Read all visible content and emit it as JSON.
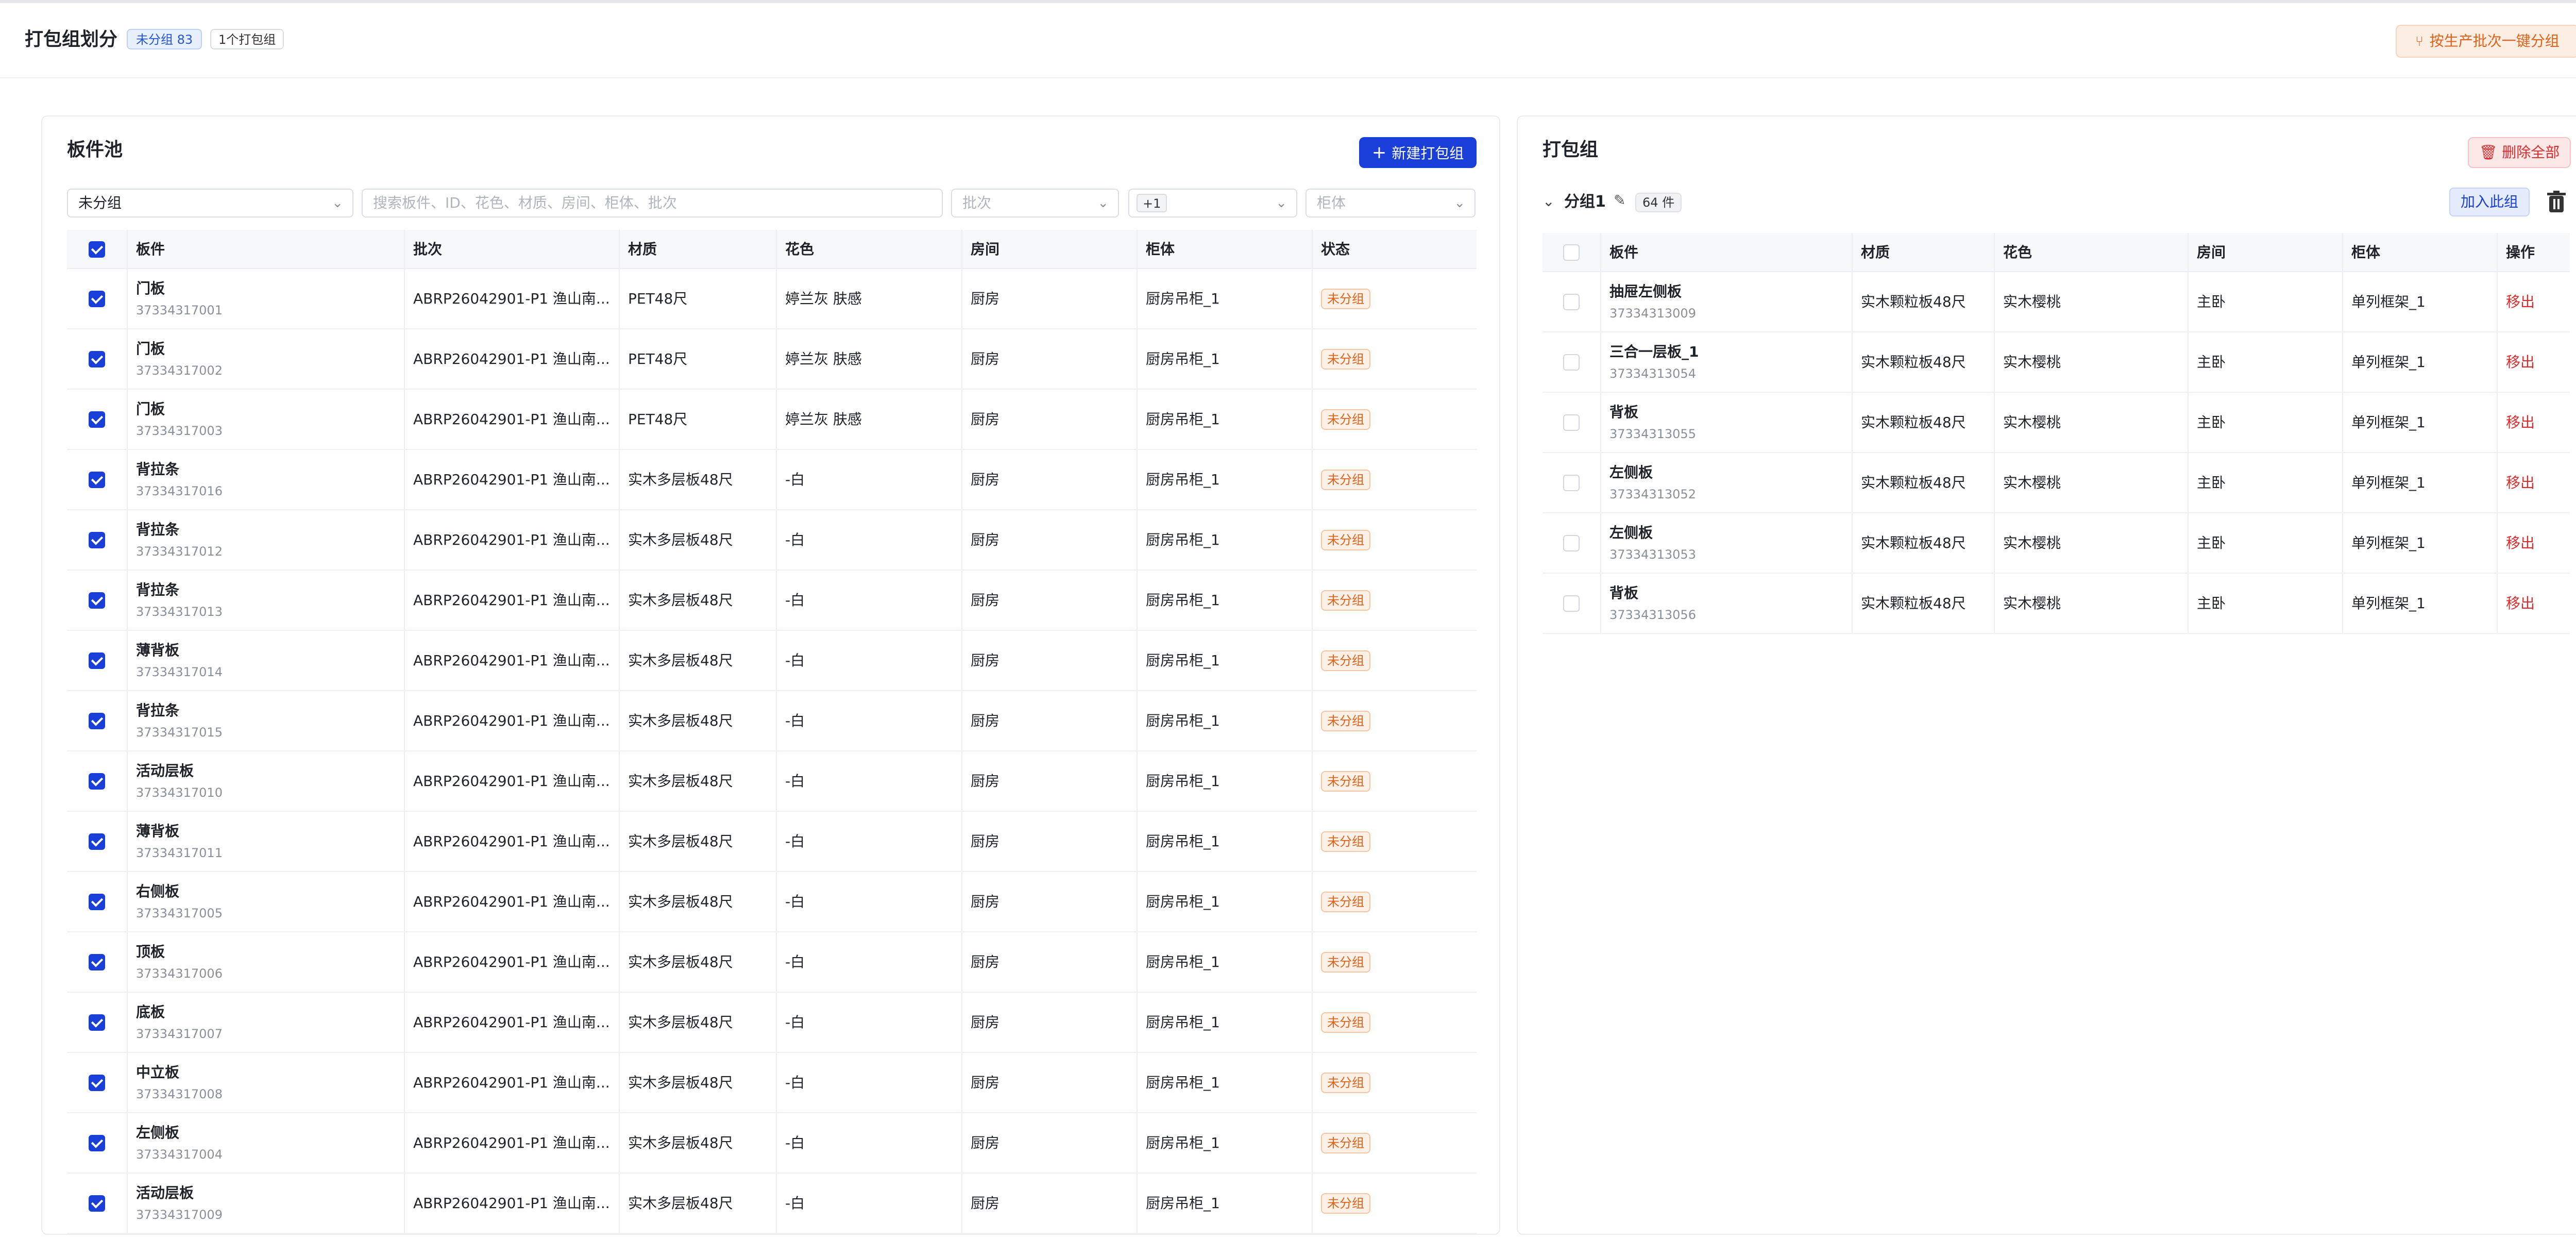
{
  "header": {
    "title": "打包组划分",
    "ungrouped_badge": "未分组 83",
    "group_count_badge": "1个打包组",
    "auto_group_button": "按生产批次一键分组",
    "close": "✕"
  },
  "pool": {
    "title": "板件池",
    "new_group_button": "新建打包组",
    "filter_group": "未分组",
    "search_placeholder": "搜索板件、ID、花色、材质、房间、柜体、批次",
    "batch_placeholder": "批次",
    "room_chip": "+1",
    "cabinet_placeholder": "柜体",
    "columns": [
      "板件",
      "批次",
      "材质",
      "花色",
      "房间",
      "柜体",
      "状态"
    ],
    "rows": [
      {
        "name": "门板",
        "id": "37334317001",
        "batch": "ABRP26042901-P1 渔山南...",
        "material": "PET48尺",
        "color": "婷兰灰 肤感",
        "room": "厨房",
        "cabinet": "厨房吊柜_1",
        "status": "未分组"
      },
      {
        "name": "门板",
        "id": "37334317002",
        "batch": "ABRP26042901-P1 渔山南...",
        "material": "PET48尺",
        "color": "婷兰灰 肤感",
        "room": "厨房",
        "cabinet": "厨房吊柜_1",
        "status": "未分组"
      },
      {
        "name": "门板",
        "id": "37334317003",
        "batch": "ABRP26042901-P1 渔山南...",
        "material": "PET48尺",
        "color": "婷兰灰 肤感",
        "room": "厨房",
        "cabinet": "厨房吊柜_1",
        "status": "未分组"
      },
      {
        "name": "背拉条",
        "id": "37334317016",
        "batch": "ABRP26042901-P1 渔山南...",
        "material": "实木多层板48尺",
        "color": "-白",
        "room": "厨房",
        "cabinet": "厨房吊柜_1",
        "status": "未分组"
      },
      {
        "name": "背拉条",
        "id": "37334317012",
        "batch": "ABRP26042901-P1 渔山南...",
        "material": "实木多层板48尺",
        "color": "-白",
        "room": "厨房",
        "cabinet": "厨房吊柜_1",
        "status": "未分组"
      },
      {
        "name": "背拉条",
        "id": "37334317013",
        "batch": "ABRP26042901-P1 渔山南...",
        "material": "实木多层板48尺",
        "color": "-白",
        "room": "厨房",
        "cabinet": "厨房吊柜_1",
        "status": "未分组"
      },
      {
        "name": "薄背板",
        "id": "37334317014",
        "batch": "ABRP26042901-P1 渔山南...",
        "material": "实木多层板48尺",
        "color": "-白",
        "room": "厨房",
        "cabinet": "厨房吊柜_1",
        "status": "未分组"
      },
      {
        "name": "背拉条",
        "id": "37334317015",
        "batch": "ABRP26042901-P1 渔山南...",
        "material": "实木多层板48尺",
        "color": "-白",
        "room": "厨房",
        "cabinet": "厨房吊柜_1",
        "status": "未分组"
      },
      {
        "name": "活动层板",
        "id": "37334317010",
        "batch": "ABRP26042901-P1 渔山南...",
        "material": "实木多层板48尺",
        "color": "-白",
        "room": "厨房",
        "cabinet": "厨房吊柜_1",
        "status": "未分组"
      },
      {
        "name": "薄背板",
        "id": "37334317011",
        "batch": "ABRP26042901-P1 渔山南...",
        "material": "实木多层板48尺",
        "color": "-白",
        "room": "厨房",
        "cabinet": "厨房吊柜_1",
        "status": "未分组"
      },
      {
        "name": "右侧板",
        "id": "37334317005",
        "batch": "ABRP26042901-P1 渔山南...",
        "material": "实木多层板48尺",
        "color": "-白",
        "room": "厨房",
        "cabinet": "厨房吊柜_1",
        "status": "未分组"
      },
      {
        "name": "顶板",
        "id": "37334317006",
        "batch": "ABRP26042901-P1 渔山南...",
        "material": "实木多层板48尺",
        "color": "-白",
        "room": "厨房",
        "cabinet": "厨房吊柜_1",
        "status": "未分组"
      },
      {
        "name": "底板",
        "id": "37334317007",
        "batch": "ABRP26042901-P1 渔山南...",
        "material": "实木多层板48尺",
        "color": "-白",
        "room": "厨房",
        "cabinet": "厨房吊柜_1",
        "status": "未分组"
      },
      {
        "name": "中立板",
        "id": "37334317008",
        "batch": "ABRP26042901-P1 渔山南...",
        "material": "实木多层板48尺",
        "color": "-白",
        "room": "厨房",
        "cabinet": "厨房吊柜_1",
        "status": "未分组"
      },
      {
        "name": "左侧板",
        "id": "37334317004",
        "batch": "ABRP26042901-P1 渔山南...",
        "material": "实木多层板48尺",
        "color": "-白",
        "room": "厨房",
        "cabinet": "厨房吊柜_1",
        "status": "未分组"
      },
      {
        "name": "活动层板",
        "id": "37334317009",
        "batch": "ABRP26042901-P1 渔山南...",
        "material": "实木多层板48尺",
        "color": "-白",
        "room": "厨房",
        "cabinet": "厨房吊柜_1",
        "status": "未分组"
      }
    ]
  },
  "groups": {
    "title": "打包组",
    "delete_all_button": "删除全部",
    "group": {
      "name": "分组1",
      "count": "64 件",
      "join_button": "加入此组"
    },
    "columns": [
      "板件",
      "材质",
      "花色",
      "房间",
      "柜体",
      "操作"
    ],
    "rows": [
      {
        "name": "抽屉左侧板",
        "id": "37334313009",
        "material": "实木颗粒板48尺",
        "color": "实木樱桃",
        "room": "主卧",
        "cabinet": "单列框架_1",
        "action": "移出"
      },
      {
        "name": "三合一层板_1",
        "id": "37334313054",
        "material": "实木颗粒板48尺",
        "color": "实木樱桃",
        "room": "主卧",
        "cabinet": "单列框架_1",
        "action": "移出"
      },
      {
        "name": "背板",
        "id": "37334313055",
        "material": "实木颗粒板48尺",
        "color": "实木樱桃",
        "room": "主卧",
        "cabinet": "单列框架_1",
        "action": "移出"
      },
      {
        "name": "左侧板",
        "id": "37334313052",
        "material": "实木颗粒板48尺",
        "color": "实木樱桃",
        "room": "主卧",
        "cabinet": "单列框架_1",
        "action": "移出"
      },
      {
        "name": "左侧板",
        "id": "37334313053",
        "material": "实木颗粒板48尺",
        "color": "实木樱桃",
        "room": "主卧",
        "cabinet": "单列框架_1",
        "action": "移出"
      },
      {
        "name": "背板",
        "id": "37334313056",
        "material": "实木颗粒板48尺",
        "color": "实木樱桃",
        "room": "主卧",
        "cabinet": "单列框架_1",
        "action": "移出"
      }
    ]
  },
  "colors": {
    "primary": "#1a3fd8",
    "status_orange": "#e0621a",
    "danger_red": "#d92d2d"
  }
}
